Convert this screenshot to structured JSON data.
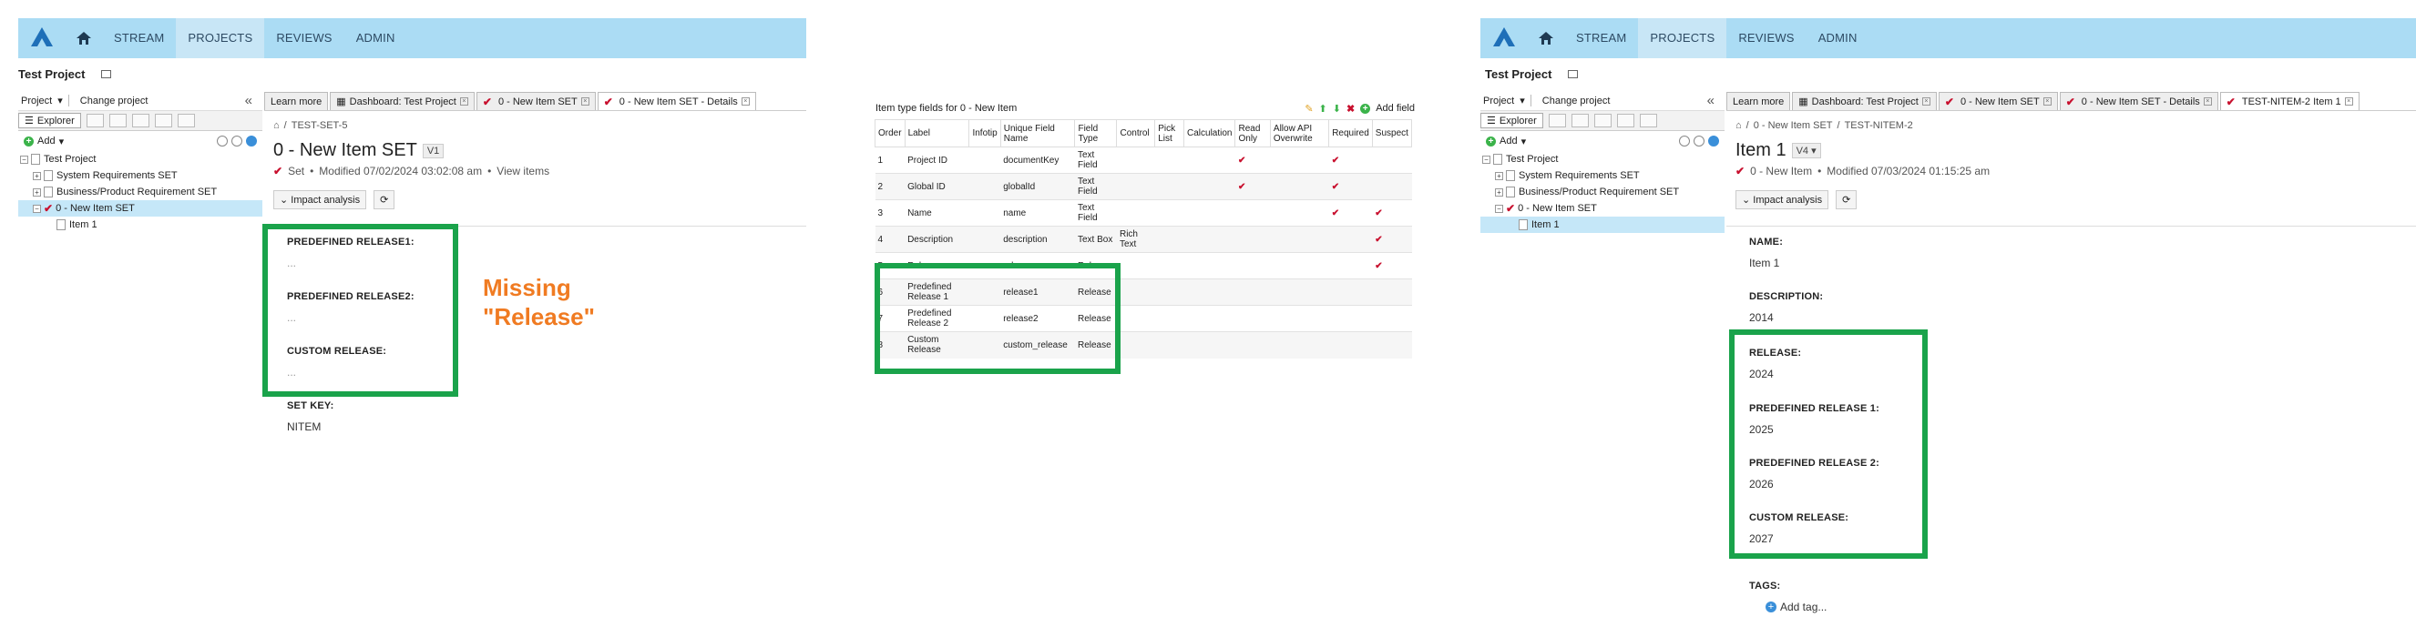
{
  "nav": {
    "items": [
      "STREAM",
      "PROJECTS",
      "REVIEWS",
      "ADMIN"
    ],
    "active": "PROJECTS"
  },
  "project": {
    "name": "Test Project"
  },
  "sidebar": {
    "project_menu": "Project",
    "change_project": "Change project",
    "explorer_tab": "Explorer",
    "add_label": "Add",
    "tree": [
      "Test Project",
      "System Requirements SET",
      "Business/Product Requirement SET",
      "0 - New Item SET",
      "Item 1"
    ]
  },
  "left": {
    "tabs": [
      "Learn more",
      "Dashboard: Test Project",
      "0 - New Item SET",
      "0 - New Item SET - Details"
    ],
    "breadcrumb": "TEST-SET-5",
    "title": "0 - New Item SET",
    "version": "V1",
    "meta": {
      "status": "Set",
      "modified": "Modified 07/02/2024 03:02:08 am",
      "link": "View items"
    },
    "impact": "Impact analysis",
    "fields": [
      {
        "label": "PREDEFINED RELEASE1:",
        "value": "..."
      },
      {
        "label": "PREDEFINED RELEASE2:",
        "value": "..."
      },
      {
        "label": "CUSTOM RELEASE:",
        "value": "..."
      },
      {
        "label": "SET KEY:",
        "value": "NITEM"
      }
    ],
    "annotation": {
      "line1": "Missing",
      "line2": "\"Release\""
    }
  },
  "middle": {
    "title": "Item type fields for 0 - New Item",
    "add_field": "Add field",
    "columns": [
      "Order",
      "Label",
      "Infotip",
      "Unique Field Name",
      "Field Type",
      "Control",
      "Pick List",
      "Calculation",
      "Read Only",
      "Allow API Overwrite",
      "Required",
      "Suspect"
    ],
    "rows": [
      {
        "order": "1",
        "label": "Project ID",
        "name": "documentKey",
        "type": "Text Field",
        "control": "",
        "ro": true,
        "req": true,
        "sus": false
      },
      {
        "order": "2",
        "label": "Global ID",
        "name": "globalId",
        "type": "Text Field",
        "control": "",
        "ro": true,
        "req": true,
        "sus": false
      },
      {
        "order": "3",
        "label": "Name",
        "name": "name",
        "type": "Text Field",
        "control": "",
        "ro": false,
        "req": true,
        "sus": true
      },
      {
        "order": "4",
        "label": "Description",
        "name": "description",
        "type": "Text Box",
        "control": "Rich Text",
        "ro": false,
        "req": false,
        "sus": true
      },
      {
        "order": "5",
        "label": "Release",
        "name": "release",
        "type": "Release",
        "control": "",
        "ro": false,
        "req": false,
        "sus": true
      },
      {
        "order": "6",
        "label": "Predefined Release 1",
        "name": "release1",
        "type": "Release",
        "control": "",
        "ro": false,
        "req": false,
        "sus": false
      },
      {
        "order": "7",
        "label": "Predefined Release 2",
        "name": "release2",
        "type": "Release",
        "control": "",
        "ro": false,
        "req": false,
        "sus": false
      },
      {
        "order": "8",
        "label": "Custom Release",
        "name": "custom_release",
        "type": "Release",
        "control": "",
        "ro": false,
        "req": false,
        "sus": false
      }
    ]
  },
  "right": {
    "tabs": [
      "Learn more",
      "Dashboard: Test Project",
      "0 - New Item SET",
      "0 - New Item SET - Details",
      "TEST-NITEM-2 Item 1"
    ],
    "breadcrumb": [
      "0 - New Item SET",
      "TEST-NITEM-2"
    ],
    "title": "Item 1",
    "version": "V4",
    "meta": {
      "status": "0 - New Item",
      "modified": "Modified 07/03/2024 01:15:25 am"
    },
    "impact": "Impact analysis",
    "fields": [
      {
        "label": "NAME:",
        "value": "Item 1"
      },
      {
        "label": "DESCRIPTION:",
        "value": "2014"
      },
      {
        "label": "RELEASE:",
        "value": "2024"
      },
      {
        "label": "PREDEFINED RELEASE 1:",
        "value": "2025"
      },
      {
        "label": "PREDEFINED RELEASE 2:",
        "value": "2026"
      },
      {
        "label": "CUSTOM RELEASE:",
        "value": "2027"
      },
      {
        "label": "TAGS:",
        "value": ""
      }
    ],
    "add_tag": "Add tag..."
  },
  "colors": {
    "nav_bg": "#abdcf4",
    "highlight": "#1aa34b",
    "annotation": "#f07b22",
    "check": "#c8102e"
  }
}
